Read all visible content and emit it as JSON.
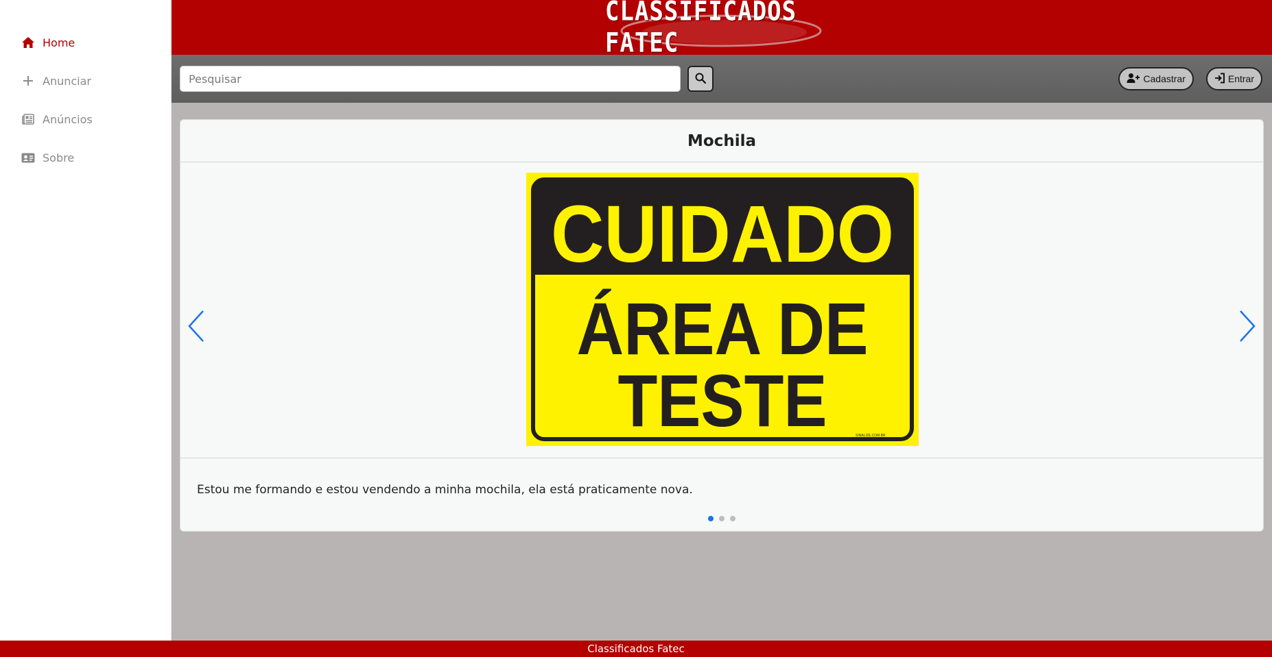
{
  "sidebar": {
    "items": [
      {
        "label": "Home",
        "icon": "home-icon",
        "active": true
      },
      {
        "label": "Anunciar",
        "icon": "plus-icon",
        "active": false
      },
      {
        "label": "Anúncios",
        "icon": "newspaper-icon",
        "active": false
      },
      {
        "label": "Sobre",
        "icon": "id-card-icon",
        "active": false
      }
    ]
  },
  "header": {
    "logo_text": "CLASSIFICADOS FATEC",
    "brand_color": "#b30000"
  },
  "toolbar": {
    "search_placeholder": "Pesquisar",
    "search_value": "",
    "signup_label": "Cadastrar",
    "login_label": "Entrar"
  },
  "card": {
    "title": "Mochila",
    "image": {
      "top_text": "CUIDADO",
      "line1": "ÁREA DE",
      "line2": "TESTE",
      "small_text": "SINALIZE.COM.BR"
    },
    "description": "Estou me formando e estou vendendo a minha mochila, ela está praticamente nova.",
    "slide_count": 3,
    "active_slide": 1
  },
  "footer": {
    "text": "Classificados Fatec"
  }
}
